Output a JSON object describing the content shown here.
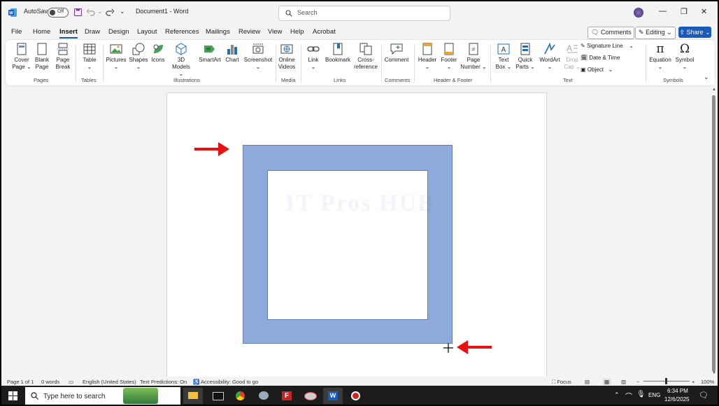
{
  "titlebar": {
    "autosave_label": "AutoSave",
    "autosave_state": "Off",
    "doc_title": "Document1  -  Word",
    "search_placeholder": "Search"
  },
  "menu": {
    "items": [
      "File",
      "Home",
      "Insert",
      "Draw",
      "Design",
      "Layout",
      "References",
      "Mailings",
      "Review",
      "View",
      "Help",
      "Acrobat"
    ],
    "active": "Insert",
    "comments": "Comments",
    "editing": "Editing",
    "share": "Share"
  },
  "ribbon": {
    "pages": {
      "cover_page": "Cover Page",
      "blank_page": "Blank Page",
      "page_break": "Page Break",
      "group": "Pages"
    },
    "tables": {
      "table": "Table",
      "group": "Tables"
    },
    "illustrations": {
      "pictures": "Pictures",
      "shapes": "Shapes",
      "icons": "Icons",
      "models": "3D Models",
      "smartart": "SmartArt",
      "chart": "Chart",
      "screenshot": "Screenshot",
      "group": "Illustrations"
    },
    "media": {
      "online_videos": "Online Videos",
      "group": "Media"
    },
    "links": {
      "link": "Link",
      "bookmark": "Bookmark",
      "cross_reference": "Cross-reference",
      "group": "Links"
    },
    "comments": {
      "comment": "Comment",
      "group": "Comments"
    },
    "header_footer": {
      "header": "Header",
      "footer": "Footer",
      "page_number": "Page Number",
      "group": "Header & Footer"
    },
    "text": {
      "text_box": "Text Box",
      "quick_parts": "Quick Parts",
      "wordart": "WordArt",
      "drop_cap": "Drop Cap",
      "signature_line": "Signature Line",
      "date_time": "Date & Time",
      "object": "Object",
      "group": "Text"
    },
    "symbols": {
      "equation": "Equation",
      "symbol": "Symbol",
      "group": "Symbols"
    }
  },
  "document": {
    "watermark": "IT Pros HUB",
    "shape_fill": "#8faadc"
  },
  "status": {
    "page": "Page 1 of 1",
    "words": "0 words",
    "language": "English (United States)",
    "predictions": "Text Predictions: On",
    "accessibility": "Accessibility: Good to go",
    "focus": "Focus",
    "zoom": "100%"
  },
  "taskbar": {
    "search_placeholder": "Type here to search",
    "time": "6:34 PM",
    "date": "12/6/2025",
    "lang": "ENG"
  }
}
